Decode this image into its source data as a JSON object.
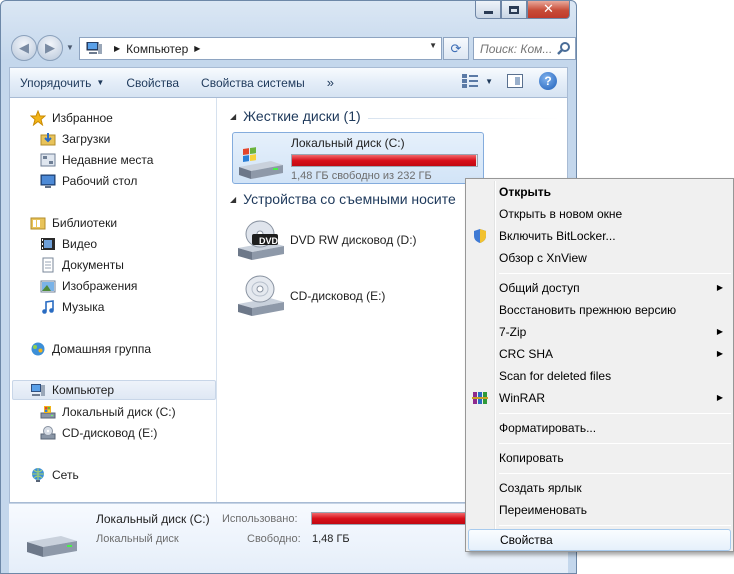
{
  "window": {
    "caption_close": "✕"
  },
  "nav": {
    "back_glyph": "◀",
    "forward_glyph": "▶",
    "refresh_glyph": "⟳"
  },
  "address": {
    "path": "Компьютер",
    "sep_glyph": "▶"
  },
  "search": {
    "placeholder": "Поиск: Ком..."
  },
  "toolbar": {
    "organize": "Упорядочить",
    "properties": "Свойства",
    "system_properties": "Свойства системы",
    "more": "»"
  },
  "sidebar": {
    "favorites": "Избранное",
    "downloads": "Загрузки",
    "recent": "Недавние места",
    "desktop": "Рабочий стол",
    "libraries": "Библиотеки",
    "video": "Видео",
    "documents": "Документы",
    "pictures": "Изображения",
    "music": "Музыка",
    "homegroup": "Домашняя группа",
    "computer": "Компьютер",
    "local_disk": "Локальный диск (C:)",
    "cd_drive": "CD-дисковод (E:)",
    "network": "Сеть"
  },
  "main": {
    "hard_disks_header": "Жесткие диски (1)",
    "removable_header": "Устройства со съемными носите",
    "drive_c": {
      "name": "Локальный диск (C:)",
      "free_text": "1,48 ГБ свободно из 232 ГБ",
      "used_fraction": 0.994
    },
    "dvd": {
      "name": "DVD RW дисковод (D:)",
      "badge": "DVD"
    },
    "cd": {
      "name": "CD-дисковод (E:)"
    }
  },
  "details": {
    "title": "Локальный диск (C:)",
    "subtitle": "Локальный диск",
    "used_label": "Использовано:",
    "free_label": "Свободно:",
    "free_value": "1,48 ГБ"
  },
  "context_menu": {
    "items": [
      {
        "label": "Открыть",
        "bold": true
      },
      {
        "label": "Открыть в новом окне"
      },
      {
        "label": "Включить BitLocker..."
      },
      {
        "label": "Обзор с XnView"
      },
      {
        "label": "Общий доступ",
        "submenu": true
      },
      {
        "label": "Восстановить прежнюю версию"
      },
      {
        "label": "7-Zip",
        "submenu": true
      },
      {
        "label": "CRC SHA",
        "submenu": true
      },
      {
        "label": "Scan for deleted files"
      },
      {
        "label": "WinRAR",
        "submenu": true
      },
      {
        "label": "Форматировать..."
      },
      {
        "label": "Копировать"
      },
      {
        "label": "Создать ярлык"
      },
      {
        "label": "Переименовать"
      },
      {
        "label": "Свойства",
        "hover": true
      }
    ],
    "submenu_glyph": "▶"
  },
  "colors": {
    "accent": "#1e395b",
    "disk_bar_full": "#d8101a",
    "selection": "#d2e4f7"
  }
}
